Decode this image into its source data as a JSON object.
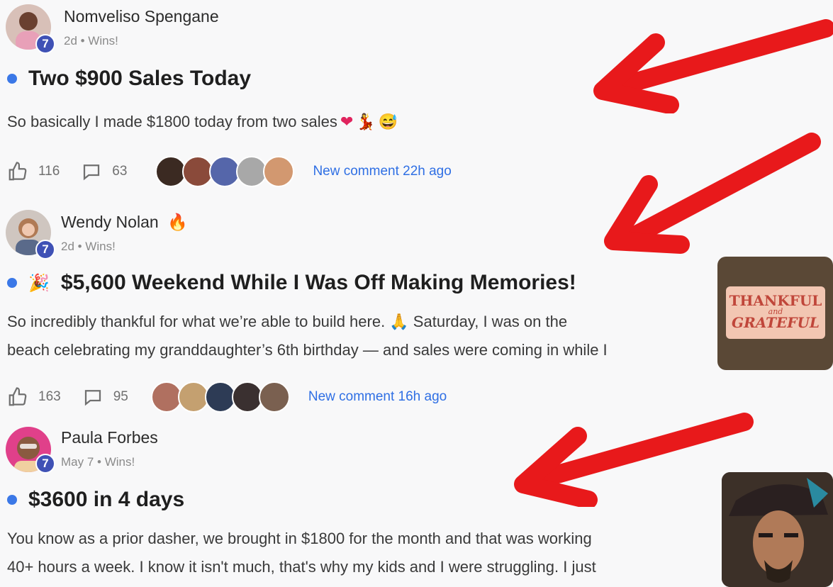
{
  "posts": [
    {
      "author": "Nomveliso Spengane",
      "level": "7",
      "meta": "2d • Wins!",
      "title": "Two $900 Sales Today",
      "body": [
        "So basically I made $1800 today from two sales"
      ],
      "body_emojis": [
        "❤",
        "💃",
        "😅"
      ],
      "likes": "116",
      "comments": "63",
      "new_comment": "New comment 22h ago",
      "face_colors": [
        "#3b2a22",
        "#8a4a3a",
        "#5566aa",
        "#a8a8a8",
        "#d29870"
      ]
    },
    {
      "author": "Wendy Nolan",
      "author_badge_icon": "fire-icon",
      "level": "7",
      "meta": "2d • Wins!",
      "title_emoji": "🎉",
      "title": "$5,600 Weekend While I Was Off Making Memories!",
      "body": [
        "So incredibly thankful for what we’re able to build here. 🙏 Saturday, I was on the",
        "beach celebrating my granddaughter’s 6th birthday — and sales were coming in while I"
      ],
      "likes": "163",
      "comments": "95",
      "new_comment": "New comment 16h ago",
      "face_colors": [
        "#b07060",
        "#c4a070",
        "#2d3b55",
        "#3a3030",
        "#7a6050"
      ],
      "thumbnail_text": [
        "THANKFUL",
        "and",
        "GRATEFUL"
      ]
    },
    {
      "author": "Paula Forbes",
      "level": "7",
      "meta": "May 7 • Wins!",
      "title": "$3600 in 4 days",
      "body": [
        "You know as a prior dasher, we brought in $1800 for the month and that was working",
        "40+ hours a week. I know it isn't much, that's why my kids and I were struggling. I just"
      ]
    }
  ],
  "colors": {
    "accent": "#3b78e7",
    "arrow": "#e8191b",
    "level_badge": "#3f51b5"
  }
}
